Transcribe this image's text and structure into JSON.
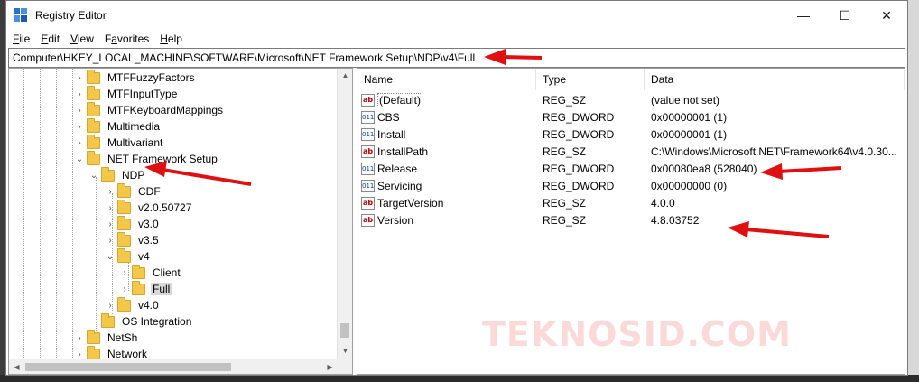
{
  "window": {
    "title": "Registry Editor",
    "controls": {
      "minimize": "—",
      "maximize": "☐",
      "close": "✕"
    }
  },
  "menu": [
    {
      "key": "F",
      "rest": "ile"
    },
    {
      "key": "E",
      "rest": "dit"
    },
    {
      "key": "V",
      "rest": "iew"
    },
    {
      "key": "",
      "rest": "Favorites",
      "prefix": "F",
      "underline_index": 1
    },
    {
      "key": "H",
      "rest": "elp"
    }
  ],
  "menu_labels": {
    "file": "F",
    "file_rest": "ile",
    "edit": "E",
    "edit_rest": "dit",
    "view": "V",
    "view_rest": "iew",
    "fav_pre": "F",
    "fav_key": "a",
    "fav_rest": "vorites",
    "help": "H",
    "help_rest": "elp"
  },
  "address": "Computer\\HKEY_LOCAL_MACHINE\\SOFTWARE\\Microsoft\\NET Framework Setup\\NDP\\v4\\Full",
  "tree": {
    "items": [
      {
        "label": "MTFFuzzyFactors",
        "expander": "›"
      },
      {
        "label": "MTFInputType",
        "expander": "›"
      },
      {
        "label": "MTFKeyboardMappings",
        "expander": "›"
      },
      {
        "label": "Multimedia",
        "expander": "›"
      },
      {
        "label": "Multivariant",
        "expander": "›"
      },
      {
        "label": "NET Framework Setup",
        "expander": "⌄"
      },
      {
        "label": "NDP",
        "expander": "⌄"
      },
      {
        "label": "CDF",
        "expander": "›"
      },
      {
        "label": "v2.0.50727",
        "expander": "›"
      },
      {
        "label": "v3.0",
        "expander": "›"
      },
      {
        "label": "v3.5",
        "expander": "›"
      },
      {
        "label": "v4",
        "expander": "⌄"
      },
      {
        "label": "Client",
        "expander": "›"
      },
      {
        "label": "Full",
        "expander": "›"
      },
      {
        "label": "v4.0",
        "expander": "›"
      },
      {
        "label": "OS Integration",
        "expander": ""
      },
      {
        "label": "NetSh",
        "expander": "›"
      },
      {
        "label": "Network",
        "expander": "›"
      }
    ]
  },
  "list": {
    "columns": [
      "Name",
      "Type",
      "Data"
    ],
    "rows": [
      {
        "icon": "ab",
        "name": "(Default)",
        "type": "REG_SZ",
        "data": "(value not set)"
      },
      {
        "icon": "011",
        "name": "CBS",
        "type": "REG_DWORD",
        "data": "0x00000001 (1)"
      },
      {
        "icon": "011",
        "name": "Install",
        "type": "REG_DWORD",
        "data": "0x00000001 (1)"
      },
      {
        "icon": "ab",
        "name": "InstallPath",
        "type": "REG_SZ",
        "data": "C:\\Windows\\Microsoft.NET\\Framework64\\v4.0.30..."
      },
      {
        "icon": "011",
        "name": "Release",
        "type": "REG_DWORD",
        "data": "0x00080ea8 (528040)"
      },
      {
        "icon": "011",
        "name": "Servicing",
        "type": "REG_DWORD",
        "data": "0x00000000 (0)"
      },
      {
        "icon": "ab",
        "name": "TargetVersion",
        "type": "REG_SZ",
        "data": "4.0.0"
      },
      {
        "icon": "ab",
        "name": "Version",
        "type": "REG_SZ",
        "data": "4.8.03752"
      }
    ]
  },
  "watermark": "TEKNOSID.COM",
  "colors": {
    "arrow": "#e01010",
    "watermark": "#f07878",
    "folder": "#f3c74a",
    "selection": "#d9d9d9"
  }
}
